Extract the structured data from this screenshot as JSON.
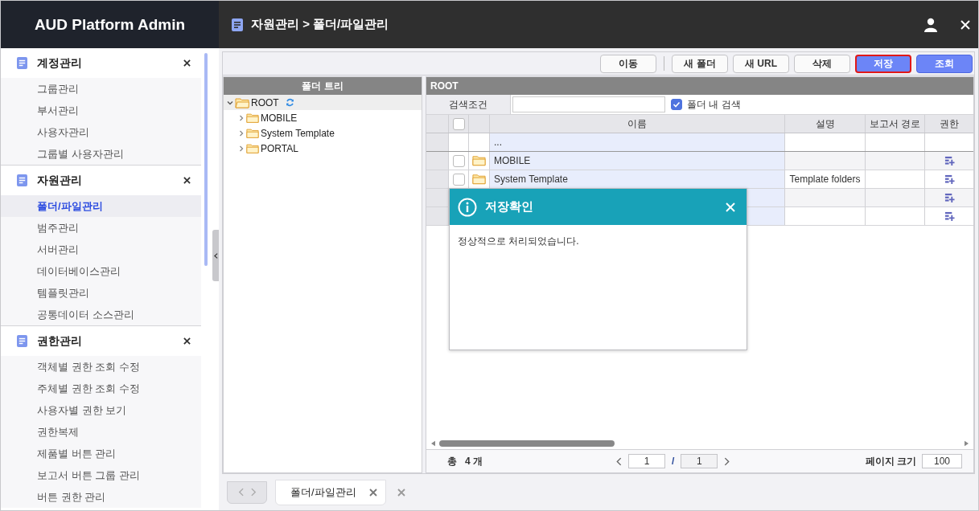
{
  "app": {
    "title": "AUD Platform Admin",
    "breadcrumb": "자원관리 > 폴더/파일관리"
  },
  "sidebar": {
    "sections": [
      {
        "title": "계정관리",
        "items": [
          {
            "label": "그룹관리",
            "selected": false
          },
          {
            "label": "부서관리",
            "selected": false
          },
          {
            "label": "사용자관리",
            "selected": false
          },
          {
            "label": "그룹별 사용자관리",
            "selected": false
          }
        ]
      },
      {
        "title": "자원관리",
        "items": [
          {
            "label": "폴더/파일관리",
            "selected": true
          },
          {
            "label": "범주관리",
            "selected": false
          },
          {
            "label": "서버관리",
            "selected": false
          },
          {
            "label": "데이터베이스관리",
            "selected": false
          },
          {
            "label": "템플릿관리",
            "selected": false
          },
          {
            "label": "공통데이터 소스관리",
            "selected": false
          }
        ]
      },
      {
        "title": "권한관리",
        "items": [
          {
            "label": "객체별 권한 조회 수정",
            "selected": false
          },
          {
            "label": "주체별 권한 조회 수정",
            "selected": false
          },
          {
            "label": "사용자별 권한 보기",
            "selected": false
          },
          {
            "label": "권한복제",
            "selected": false
          },
          {
            "label": "제품별 버튼 관리",
            "selected": false
          },
          {
            "label": "보고서 버튼 그룹 관리",
            "selected": false
          },
          {
            "label": "버튼 권한 관리",
            "selected": false
          }
        ]
      }
    ]
  },
  "toolbar": {
    "buttons": [
      {
        "label": "이동",
        "kind": "plain",
        "focused": false
      },
      {
        "label": "새 폴더",
        "kind": "plain",
        "focused": false
      },
      {
        "label": "새 URL",
        "kind": "plain",
        "focused": false
      },
      {
        "label": "삭제",
        "kind": "plain",
        "focused": false
      },
      {
        "label": "저장",
        "kind": "primary",
        "focused": true
      },
      {
        "label": "조회",
        "kind": "primary",
        "focused": false
      }
    ]
  },
  "folder_tree": {
    "title": "폴더 트리",
    "root": {
      "label": "ROOT",
      "expanded": true,
      "selected": true,
      "children": [
        {
          "label": "MOBILE",
          "expanded": false,
          "selected": false
        },
        {
          "label": "System Template",
          "expanded": false,
          "selected": false
        },
        {
          "label": "PORTAL",
          "expanded": false,
          "selected": false
        }
      ]
    }
  },
  "list": {
    "path": "ROOT",
    "search_label": "검색조건",
    "in_folder_label": "폴더 내 검색",
    "in_folder_checked": true,
    "all_checked": false,
    "columns": [
      "이름",
      "설명",
      "보고서 경로",
      "권한"
    ],
    "rows": [
      {
        "kind": "parent",
        "name": "..."
      },
      {
        "kind": "folder",
        "name": "MOBILE",
        "checked": false
      },
      {
        "kind": "folder",
        "name": "System Template",
        "description": "Template folders",
        "checked": false
      },
      {
        "kind": "folder"
      },
      {
        "kind": "folder"
      }
    ],
    "footer": {
      "total_label": "총",
      "total": "4",
      "unit": "개",
      "page": "1",
      "page_separator": "/",
      "pages": "1",
      "page_size_label": "페이지 크기",
      "page_size": "100"
    }
  },
  "tabs": [
    {
      "label": "폴더/파일관리",
      "selected": true
    }
  ],
  "dialog": {
    "title": "저장확인",
    "message": "정상적으로 처리되었습니다."
  }
}
